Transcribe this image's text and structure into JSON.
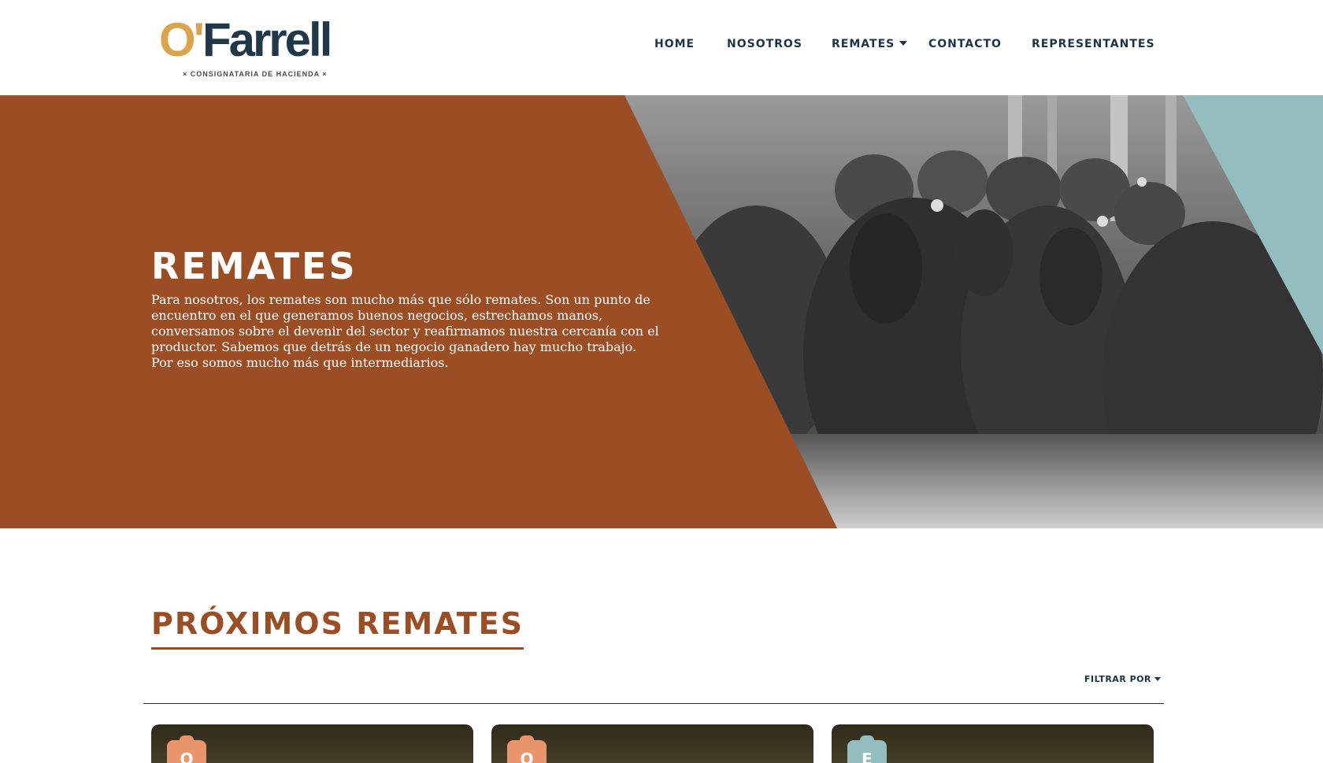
{
  "brand": {
    "logo_o": "O'",
    "logo_rest": "Farrell",
    "tagline": "× CONSIGNATARIA DE HACIENDA ×",
    "colors": {
      "gold": "#dba44a",
      "navy": "#213849",
      "rust": "#9b4d24",
      "teal": "#93bdbf"
    }
  },
  "nav": {
    "items": [
      {
        "label": "HOME",
        "has_dropdown": false
      },
      {
        "label": "NOSOTROS",
        "has_dropdown": false
      },
      {
        "label": "REMATES",
        "has_dropdown": true
      },
      {
        "label": "CONTACTO",
        "has_dropdown": false
      },
      {
        "label": "REPRESENTANTES",
        "has_dropdown": false
      }
    ]
  },
  "hero": {
    "title": "REMATES",
    "text": "Para nosotros, los remates son mucho más que sólo remates. Son un punto de encuentro en el que generamos buenos negocios, estrechamos manos, conversamos sobre el devenir del sector y reafirmamos nuestra cercanía con el productor. Sabemos que detrás de un negocio ganadero hay mucho trabajo. Por eso somos mucho más que intermediarios.",
    "image": "black-and-white photo of cattle herd in tall grass"
  },
  "upcoming": {
    "title": "PRÓXIMOS REMATES",
    "filter_label": "FILTRAR POR",
    "cards": [
      {
        "tag_letter": "O",
        "tag_color": "#e8956b"
      },
      {
        "tag_letter": "O",
        "tag_color": "#e8956b"
      },
      {
        "tag_letter": "E",
        "tag_color": "#93bdbf"
      }
    ]
  }
}
